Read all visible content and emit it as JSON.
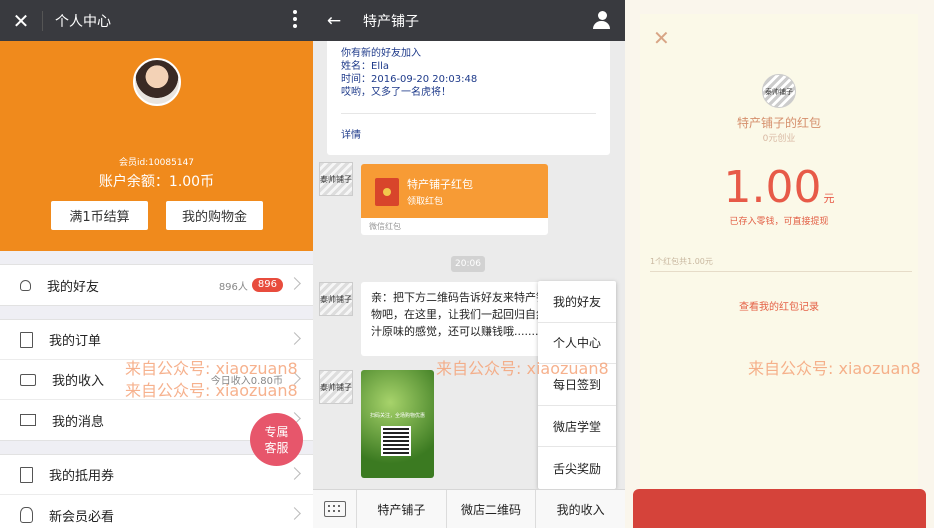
{
  "panel1": {
    "title": "个人中心",
    "member_id": "会员id:10085147",
    "balance": "账户余额：1.00币",
    "btn_checkout": "满1币结算",
    "btn_shopping_gold": "我的购物金",
    "menu": [
      {
        "label": "我的好友",
        "extra": "896人",
        "badge": "896"
      },
      {
        "label": "我的订单",
        "extra": ""
      },
      {
        "label": "我的收入",
        "extra": "今日收入0.80币"
      },
      {
        "label": "我的消息",
        "extra": ""
      },
      {
        "label": "我的抵用券",
        "extra": ""
      },
      {
        "label": "新会员必看",
        "extra": ""
      }
    ],
    "service_btn": [
      "专属",
      "客服"
    ]
  },
  "panel2": {
    "title": "特产铺子",
    "notice": {
      "line1": "你有新的好友加入",
      "line2": "姓名：Ella",
      "line3": "时间：2016-09-20 20:03:48",
      "line4": "哎哟，又多了一名虎将！",
      "detail": "详情"
    },
    "avatar_text": "泰帅铺子",
    "redpacket": {
      "title": "特产铺子红包",
      "sub": "领取红包",
      "footer": "微信红包"
    },
    "time": "20:06",
    "message": "亲：把下方二维码告诉好友来特产铺子一起购物吧，在这里，让我们一起回归自然，找到原汁原味的感觉，还可以赚钱哦.......",
    "qr_caption": "扫码关注，全场购物优惠",
    "popup_menu": [
      "我的好友",
      "个人中心",
      "每日签到",
      "微店学堂",
      "舌尖奖励"
    ],
    "bottom_bar": [
      "特产铺子",
      "微店二维码",
      "我的收入"
    ]
  },
  "panel3": {
    "logo_text": "泰帅铺子",
    "name": "特产铺子的红包",
    "sub": "0元创业",
    "amount": "1.00",
    "unit": "元",
    "note": "已存入零钱，可直接提现",
    "count": "1个红包共1.00元",
    "record_link": "查看我的红包记录"
  },
  "watermark": "来自公众号: xiaozuan8",
  "colors": {
    "orange": "#f08a1c",
    "topbar": "#393a3f",
    "red": "#e75a48",
    "badge": "#e84c3d"
  }
}
